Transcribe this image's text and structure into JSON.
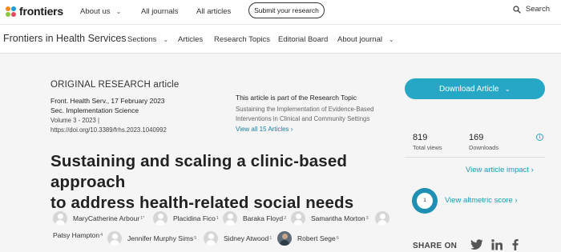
{
  "header": {
    "logo_text": "frontiers",
    "nav": [
      {
        "label": "About us",
        "has_dropdown": true
      },
      {
        "label": "All journals",
        "has_dropdown": false
      },
      {
        "label": "All articles",
        "has_dropdown": false
      }
    ],
    "submit_label": "Submit your research",
    "search_label": "Search"
  },
  "journal_nav": {
    "title": "Frontiers in Health Services",
    "items": [
      {
        "label": "Sections",
        "has_dropdown": true
      },
      {
        "label": "Articles",
        "has_dropdown": false
      },
      {
        "label": "Research Topics",
        "has_dropdown": false
      },
      {
        "label": "Editorial Board",
        "has_dropdown": false
      },
      {
        "label": "About journal",
        "has_dropdown": true
      }
    ]
  },
  "article": {
    "type": "ORIGINAL RESEARCH article",
    "citation": "Front. Health Serv., 17 February 2023",
    "section": "Sec. Implementation Science",
    "volume": "Volume 3 - 2023 |",
    "doi": "https://doi.org/10.3389/frhs.2023.1040992",
    "title_lines": [
      "Sustaining and scaling a clinic-based approach",
      "to address health-related social needs"
    ],
    "authors": [
      {
        "name": "MaryCatherine Arbour",
        "sup": "1*",
        "photo": false
      },
      {
        "name": "Placidina Fico",
        "sup": "1",
        "photo": false
      },
      {
        "name": "Baraka Floyd",
        "sup": "2",
        "photo": false
      },
      {
        "name": "Samantha Morton",
        "sup": "3",
        "photo": false
      },
      {
        "name": "Patsy Hampton",
        "sup": "4",
        "photo": false
      },
      {
        "name": "Jennifer Murphy Sims",
        "sup": "5",
        "photo": false
      },
      {
        "name": "Sidney Atwood",
        "sup": "1",
        "photo": false
      },
      {
        "name": "Robert Sege",
        "sup": "6",
        "photo": true
      }
    ]
  },
  "research_topic": {
    "heading": "This article is part of the Research Topic",
    "name_lines": [
      "Sustaining the Implementation of Evidence-Based",
      "Interventions in Clinical and Community Settings"
    ],
    "view_all": "View all 15 Articles"
  },
  "sidebar": {
    "download_label": "Download Article",
    "stats": [
      {
        "value": "819",
        "label": "Total views"
      },
      {
        "value": "169",
        "label": "Downloads"
      }
    ],
    "info_glyph": "i",
    "impact_link": "View article impact",
    "altmetric_score": "1",
    "altmetric_link": "View altmetric score",
    "share_label": "SHARE ON",
    "share_icons": [
      "twitter-icon",
      "linkedin-icon",
      "facebook-icon"
    ]
  },
  "colors": {
    "accent": "#25a7c5",
    "link": "#1a9ab8",
    "logo_orange": "#f28c1e",
    "logo_green": "#8cc63f",
    "logo_blue": "#1e9bd7"
  }
}
